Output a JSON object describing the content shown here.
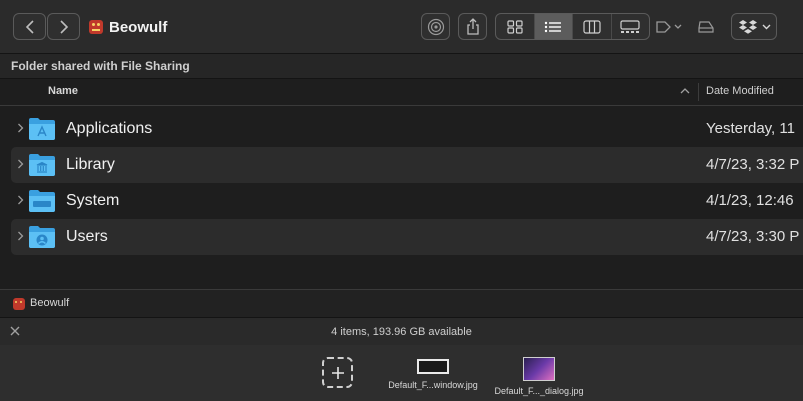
{
  "window": {
    "title": "Beowulf"
  },
  "toolbar": {
    "back_icon": "chevron-left-icon",
    "forward_icon": "chevron-right-icon",
    "views": [
      "icon-view",
      "list-view",
      "column-view",
      "gallery-view"
    ],
    "active_view": "list-view"
  },
  "path_strip": {
    "label": "Folder shared with File Sharing"
  },
  "columns": {
    "name": "Name",
    "date": "Date Modified"
  },
  "rows": [
    {
      "name": "Applications",
      "date": "Yesterday, 11",
      "icon": "applications-folder-icon"
    },
    {
      "name": "Library",
      "date": "4/7/23, 3:32 P",
      "icon": "library-folder-icon"
    },
    {
      "name": "System",
      "date": "4/1/23, 12:46",
      "icon": "system-folder-icon"
    },
    {
      "name": "Users",
      "date": "4/7/23, 3:30 P",
      "icon": "users-folder-icon"
    }
  ],
  "pathbar": {
    "item": "Beowulf"
  },
  "statusbar": {
    "text": "4 items, 193.96 GB available"
  },
  "shelf": {
    "items": [
      {
        "label": "Default_F...window.jpg"
      },
      {
        "label": "Default_F..._dialog.jpg"
      }
    ]
  },
  "colors": {
    "folder_blue": "#3aa0e0",
    "folder_blue_light": "#5cc0f5",
    "row_alt": "#2c2c2c",
    "toolbar": "#2b2b2b"
  }
}
